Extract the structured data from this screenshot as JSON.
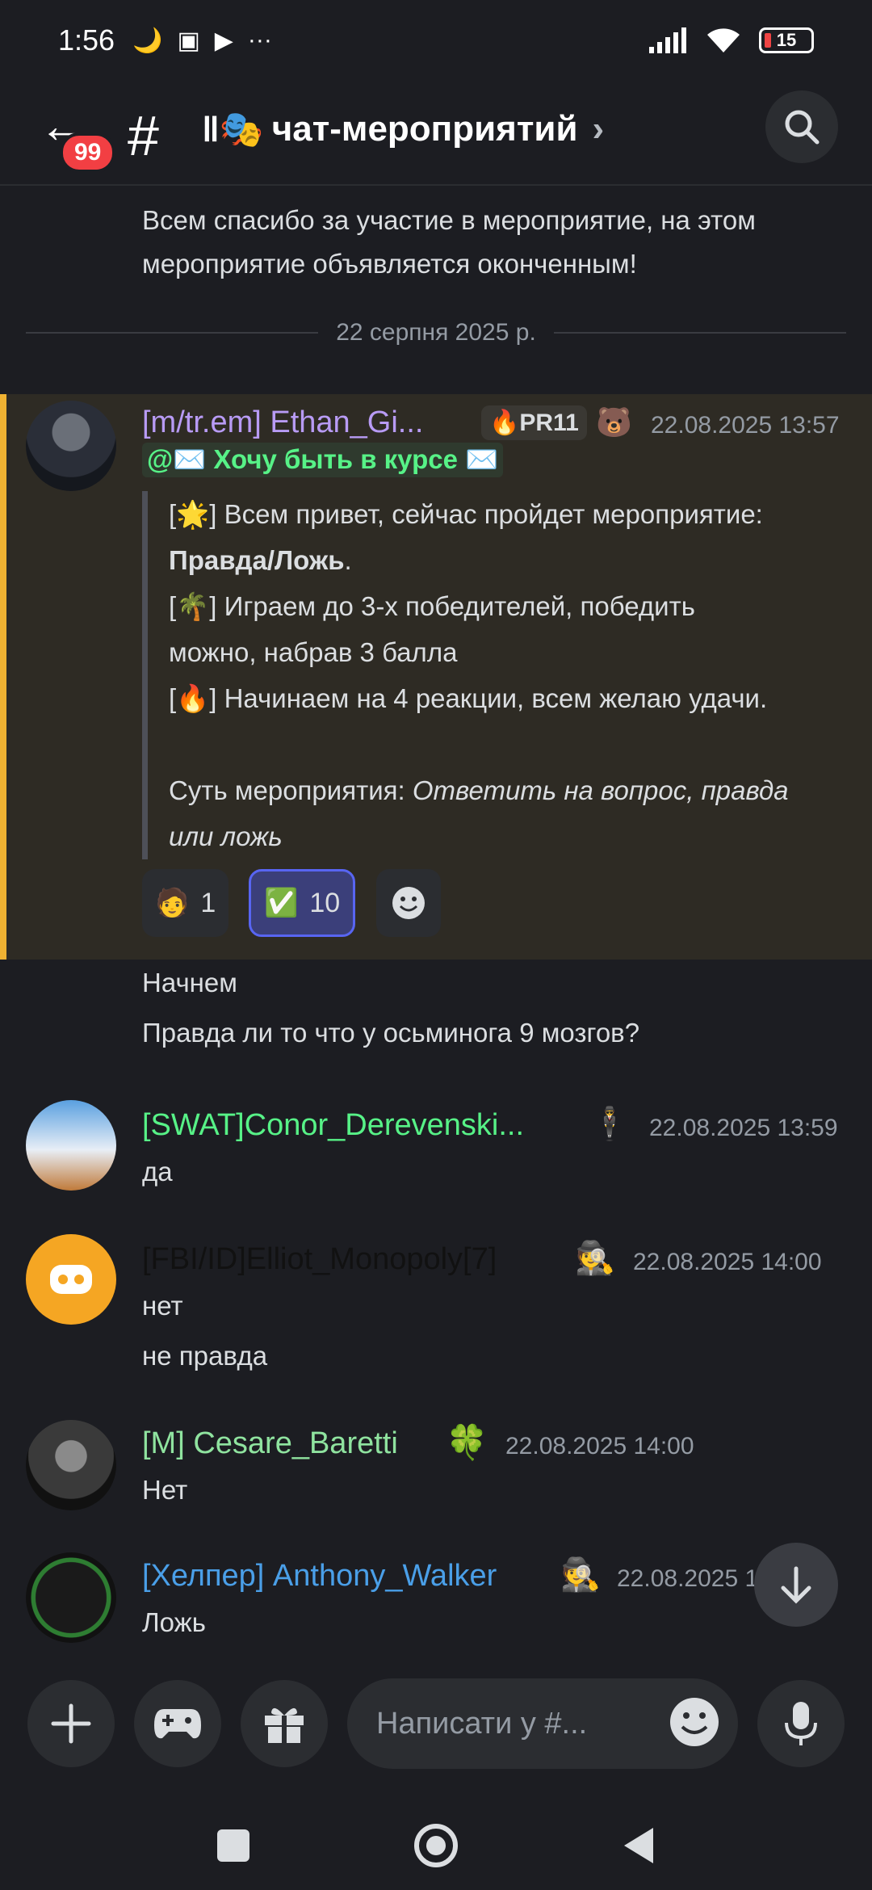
{
  "status_bar": {
    "time": "1:56",
    "battery": "15"
  },
  "header": {
    "back_badge": "99",
    "channel_prefix": "#",
    "channel_emoji": "‖🎭",
    "channel_name": "чат-мероприятий",
    "chevron": "›"
  },
  "chat": {
    "prev_message_line1": "Всем спасибо за участие в мероприятие, на этом",
    "prev_message_line2": "мероприятие объявляется оконченным!",
    "date_divider": "22 серпня 2025 р.",
    "event_post": {
      "username": "[m/tr.em] Ethan_Gi...",
      "username_color": "#b89bf5",
      "role_tag": "PR11",
      "timestamp": "22.08.2025 13:57",
      "mention": "@✉️ Хочу быть в курсе ✉️",
      "q_line1_pre": "[",
      "q_line1_emoji": "🌟",
      "q_line1": "] Всем привет, сейчас пройдет мероприятие:",
      "q_line2_bold": "Правда/Ложь",
      "q_line2_end": ".",
      "q_line3_emoji": "🌴",
      "q_line3": "] Играем до 3-х победителей, победить",
      "q_line4": "можно, набрав 3 балла",
      "q_line5_emoji": "🔥",
      "q_line5": "] Начинаем на 4 реакции, всем желаю удачи.",
      "q_line6_pre": "Суть мероприятия: ",
      "q_line6_italic": "Ответить на вопрос, правда",
      "q_line7_italic": "или ложь",
      "reactions": [
        {
          "emoji": "🧑",
          "count": "1"
        },
        {
          "emoji": "✅",
          "count": "10"
        }
      ]
    },
    "follow_up_1": "Начнем",
    "follow_up_2": "Правда ли то что у осьминога 9 мозгов?",
    "messages": [
      {
        "username": "[SWAT]Conor_Derevenski...",
        "color": "#57f287",
        "badge": "🕴",
        "timestamp": "22.08.2025 13:59",
        "lines": [
          "да"
        ]
      },
      {
        "username": "[FBI/ID]Elliot_Monopoly[7]",
        "color": "#111111",
        "badge": "🕵",
        "timestamp": "22.08.2025 14:00",
        "lines": [
          "нет",
          "не правда"
        ]
      },
      {
        "username": "[M] Cesare_Baretti",
        "color": "#8fe39f",
        "badge": "🍀",
        "timestamp": "22.08.2025 14:00",
        "lines": [
          "Нет"
        ]
      },
      {
        "username": "[Хелпер] Anthony_Walker",
        "color": "#4a9fe8",
        "badge": "🕵",
        "timestamp": "22.08.2025 1",
        "lines": [
          "Ложь"
        ]
      }
    ]
  },
  "composer": {
    "placeholder": "Написати у #..."
  },
  "colors": {
    "background": "#1c1d22",
    "highlight": "#2e2b24",
    "accent": "#f0b232",
    "brand": "#5865f2"
  }
}
